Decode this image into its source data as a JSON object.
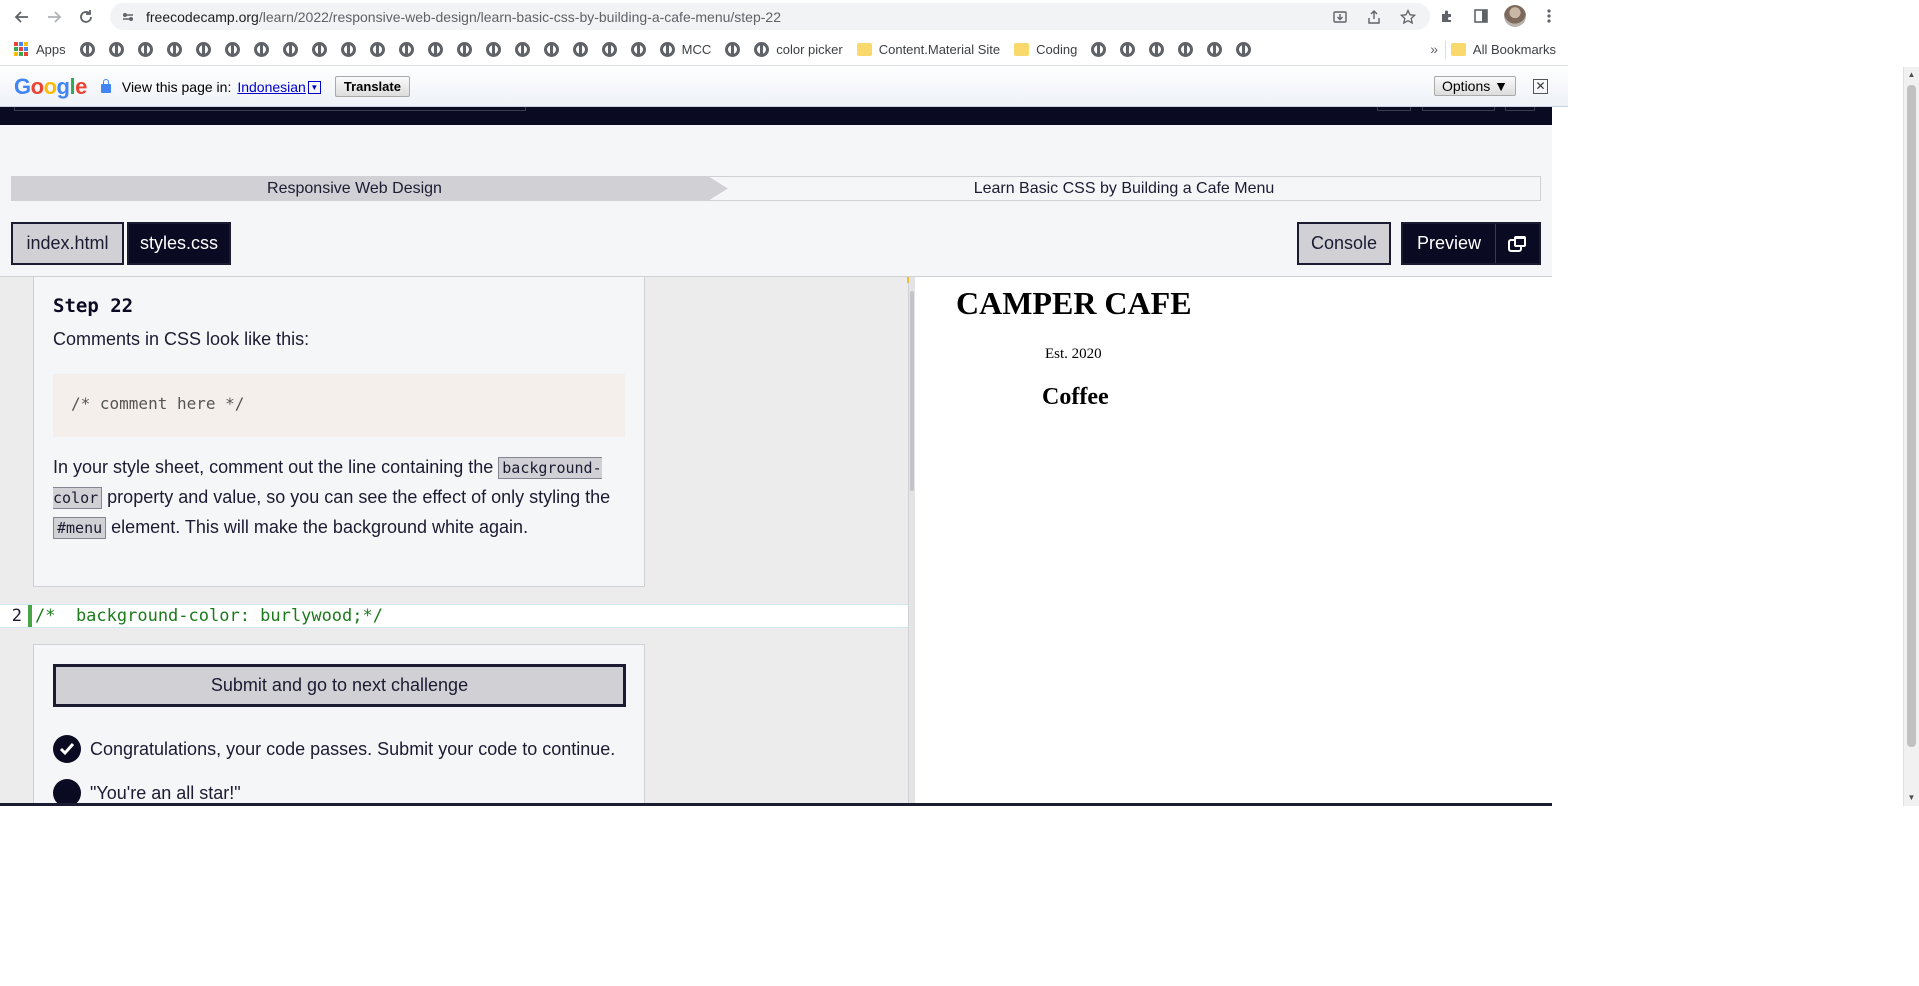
{
  "browser": {
    "url_host": "freecodecamp.org",
    "url_path": "/learn/2022/responsive-web-design/learn-basic-css-by-building-a-cafe-menu/step-22"
  },
  "bookmarks": {
    "apps": "Apps",
    "mcc": "MCC",
    "color_picker": "color picker",
    "content_material": "Content.Material Site",
    "coding": "Coding",
    "more": "»",
    "all_bookmarks": "All Bookmarks"
  },
  "translate": {
    "prompt": "View this page in:",
    "language": "Indonesian",
    "translate_button": "Translate",
    "options_button": "Options ▼",
    "close": "✕"
  },
  "breadcrumb": {
    "section": "Responsive Web Design",
    "project": "Learn Basic CSS by Building a Cafe Menu"
  },
  "tabs": {
    "index": "index.html",
    "styles": "styles.css"
  },
  "actions": {
    "console": "Console",
    "preview": "Preview"
  },
  "instructions": {
    "step_title": "Step 22",
    "intro": "Comments in CSS look like this:",
    "code_example": "/* comment here */",
    "text_part1": "In your style sheet, comment out the line containing the",
    "code1": "background-color",
    "text_part2": "property and value, so you can see the effect of only styling the",
    "code2": "#menu",
    "text_part3": "element. This will make the background white again."
  },
  "editor": {
    "line_number": "2",
    "line_code": "/*  background-color: burlywood;*/"
  },
  "result": {
    "submit_button": "Submit and go to next challenge",
    "pass_message": "Congratulations, your code passes. Submit your code to continue.",
    "quote": "\"You're an all star!\""
  },
  "preview": {
    "title": "CAMPER CAFE",
    "established": "Est. 2020",
    "section": "Coffee"
  },
  "colors": {
    "fcc_dark": "#0a0a23",
    "fcc_gray": "#d0d0d5",
    "editor_green": "#47a447",
    "google_blue": "#4285f4"
  }
}
